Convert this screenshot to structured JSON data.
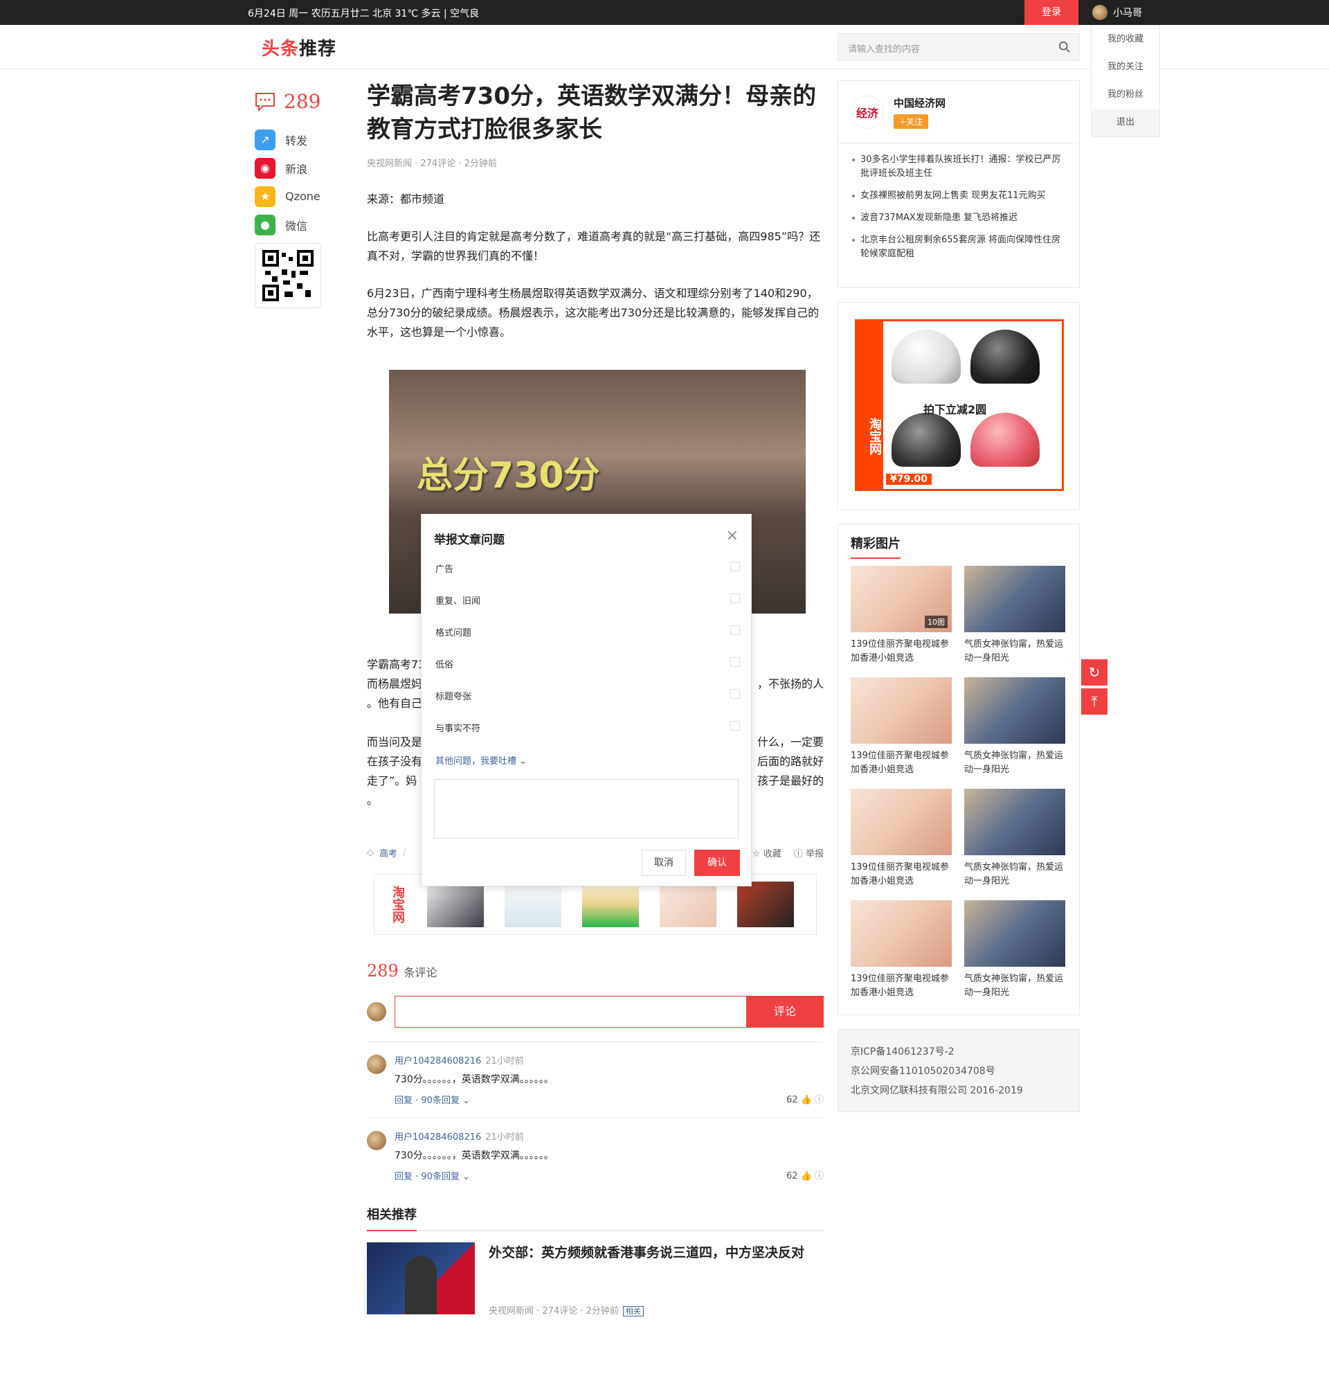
{
  "topbar": {
    "date": "6月24日 周一 农历五月廿二 北京 31℃ 多云 | 空气良",
    "login": "登录",
    "username": "小马哥"
  },
  "header": {
    "logo_a": "头条",
    "logo_b": "推荐",
    "search_placeholder": "请输入查找的内容"
  },
  "user_menu": [
    "我的收藏",
    "我的关注",
    "我的粉丝",
    "退出"
  ],
  "left": {
    "comment_count": "289",
    "share": [
      "转发",
      "新浪",
      "Qzone",
      "微信"
    ]
  },
  "article": {
    "title": "学霸高考730分，英语数学双满分！母亲的教育方式打脸很多家长",
    "meta": "央视网新闻 · 274评论 · 2分钟前",
    "p1": "来源：都市频道",
    "p2": "比高考更引人注目的肯定就是高考分数了，难道高考真的就是“高三打基础，高四985”吗？还真不对，学霸的世界我们真的不懂！",
    "p3": "6月23日，广西南宁理科考生杨晨煜取得英语数学双满分、语文和理综分别考了140和290，总分730分的破纪录成绩。杨晨煜表示，这次能考出730分还是比较满意的，能够发挥自己的水平，这也算是一个小惊喜。",
    "image_text": "总分730分",
    "p4a": "学霸高考73",
    "p4b": "而杨晨煜妈",
    "p4c": "。他有自己",
    "p4r": "，不张扬的人",
    "p5a": "而当问及是",
    "p5b": "在孩子没有",
    "p5c": "走了”。妈",
    "p5d": "。",
    "p5r1": "什么，一定要",
    "p5r2": "后面的路就好",
    "p5r3": "孩子是最好的",
    "tag": "高考",
    "collect": "收藏",
    "report": "举报",
    "ad_brand": "淘宝网"
  },
  "comments": {
    "count": "289",
    "label": "条评论",
    "submit": "评论",
    "items": [
      {
        "user": "用户104284608216",
        "time": "21小时前",
        "text": "730分。。。。。。，英语数学双满。。。。。。",
        "reply": "回复 · 90条回复",
        "likes": "62"
      },
      {
        "user": "用户104284608216",
        "time": "21小时前",
        "text": "730分。。。。。。，英语数学双满。。。。。。",
        "reply": "回复 · 90条回复",
        "likes": "62"
      }
    ]
  },
  "related": {
    "title": "相关推荐",
    "item": {
      "headline": "外交部：英方频频就香港事务说三道四，中方坚决反对",
      "meta": "央视网新闻 · 274评论 · 2分钟前",
      "tag": "相关"
    }
  },
  "media": {
    "name": "中国经济网",
    "follow": "+关注",
    "logo_text": "经济",
    "news": [
      "30多名小学生排着队挨班长打！通报：学校已严厉批评班长及班主任",
      "女孩裸照被前男友网上售卖 现男友花11元购买",
      "波音737MAX发现新隐患 复飞恐将推迟",
      "北京丰台公租房剩余655套房源 将面向保障性住房轮候家庭配租"
    ]
  },
  "side_ad": {
    "brand": "淘宝网",
    "slogan": "拍下立减2圆",
    "price": "¥79.00"
  },
  "gallery": {
    "title": "精彩图片",
    "badge": "10图",
    "captions": [
      "139位佳丽齐聚电视城参加香港小姐竞选",
      "气质女神张钧甯，热爱运动一身阳光"
    ]
  },
  "footer": [
    "京ICP备14061237号-2",
    "京公网安备11010502034708号",
    "北京文网亿联科技有限公司 2016-2019"
  ],
  "report_modal": {
    "title": "举报文章问题",
    "options": [
      "广告",
      "重复、旧闻",
      "格式问题",
      "低俗",
      "标题夸张",
      "与事实不符"
    ],
    "other": "其他问题，我要吐槽",
    "cancel": "取消",
    "confirm": "确认"
  }
}
